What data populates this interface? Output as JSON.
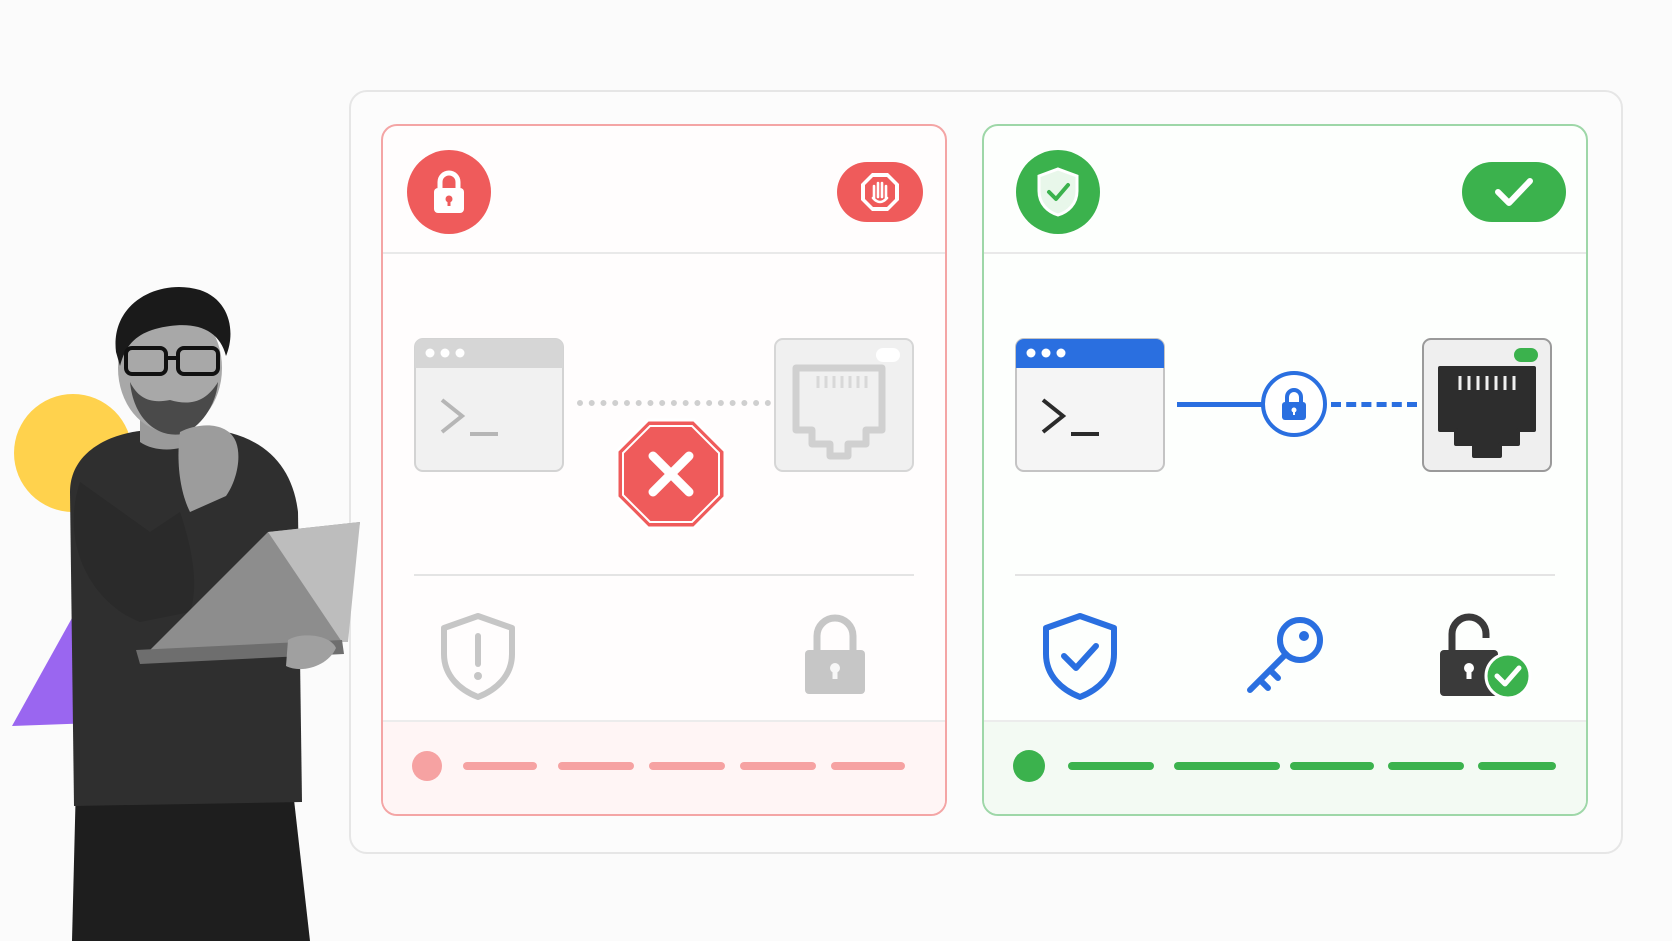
{
  "colors": {
    "blocked_red": "#ef5b5b",
    "secure_green": "#3bb24d",
    "secure_blue": "#2a6fe0",
    "muted_gray": "#c9c9c9",
    "accent_yellow": "#ffd24d",
    "accent_purple": "#9a66f0"
  },
  "blocked_panel": {
    "header_icon": "lock-icon",
    "status_badge_icon": "stop-hand-icon",
    "source_icon": "terminal-window-icon",
    "destination_icon": "ethernet-port-icon",
    "blocker_icon": "stop-x-icon",
    "footer_icons": [
      "shield-warning-icon",
      "padlock-icon"
    ],
    "progress_segments": 5
  },
  "secure_panel": {
    "header_icon": "shield-check-icon",
    "status_badge_icon": "check-icon",
    "source_icon": "terminal-window-icon",
    "tunnel_icon": "padlock-icon",
    "destination_icon": "ethernet-port-icon",
    "footer_icons": [
      "shield-check-icon",
      "key-icon",
      "unlocked-padlock-check-icon"
    ],
    "progress_segments": 5
  },
  "person": {
    "icon": "person-with-laptop-illustration"
  }
}
